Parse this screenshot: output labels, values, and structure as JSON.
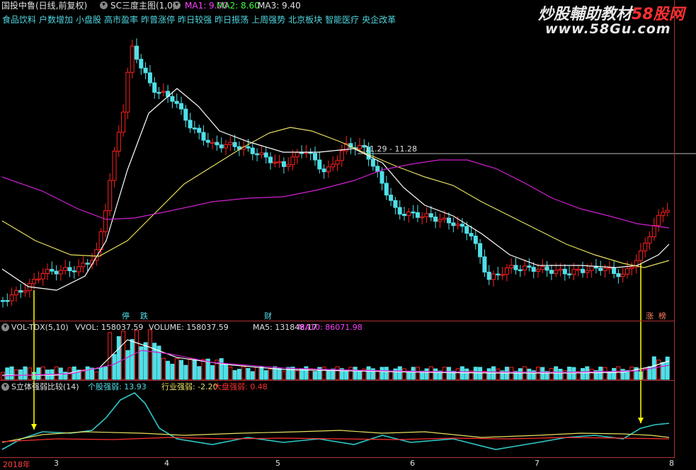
{
  "header": {
    "stock_name": "国投中鲁(日线,前复权)",
    "indicator_name": "SC三度主图(1,0)",
    "ma1": "MA1: 9.00",
    "ma2": "MA2: 8.60",
    "ma3": "MA3: 9.40"
  },
  "blocks": [
    "食品饮料",
    "户数增加",
    "小盘股",
    "高市盈率",
    "昨曾涨停",
    "昨日较强",
    "昨日振荡",
    "上周强势",
    "北京板块",
    "智能医疗",
    "央企改革"
  ],
  "watermark": {
    "line1": "炒股輔助教材",
    "brand": "58股网",
    "url": "www.58Gu.com"
  },
  "price_line_label": "11.29 - 11.28",
  "event_markers": [
    "停",
    "跌",
    "财",
    "涨",
    "榜"
  ],
  "volume_panel": {
    "title": "VOL-TDX(5,10)",
    "vvol": "VVOL: 158037.59",
    "volume": "VOLUME: 158037.59",
    "ma5": "MA5: 131848.17",
    "ma10": "MA10: 86071.98"
  },
  "strength_panel": {
    "title": "S立体强弱比较(14)",
    "stock": "个股强弱: 13.93",
    "industry": "行业强弱: -2.20",
    "market": "大盘强弱: 0.48"
  },
  "time_axis": [
    "2018年",
    "3",
    "4",
    "5",
    "6",
    "7",
    "8"
  ],
  "colors": {
    "up": "#ff2020",
    "down": "#4fe0e8",
    "ma_white": "#ffffff",
    "ma_yellow": "#e8e060",
    "ma_magenta": "#d020d0",
    "arrow": "#ffff00",
    "grid": "#b03030"
  }
}
